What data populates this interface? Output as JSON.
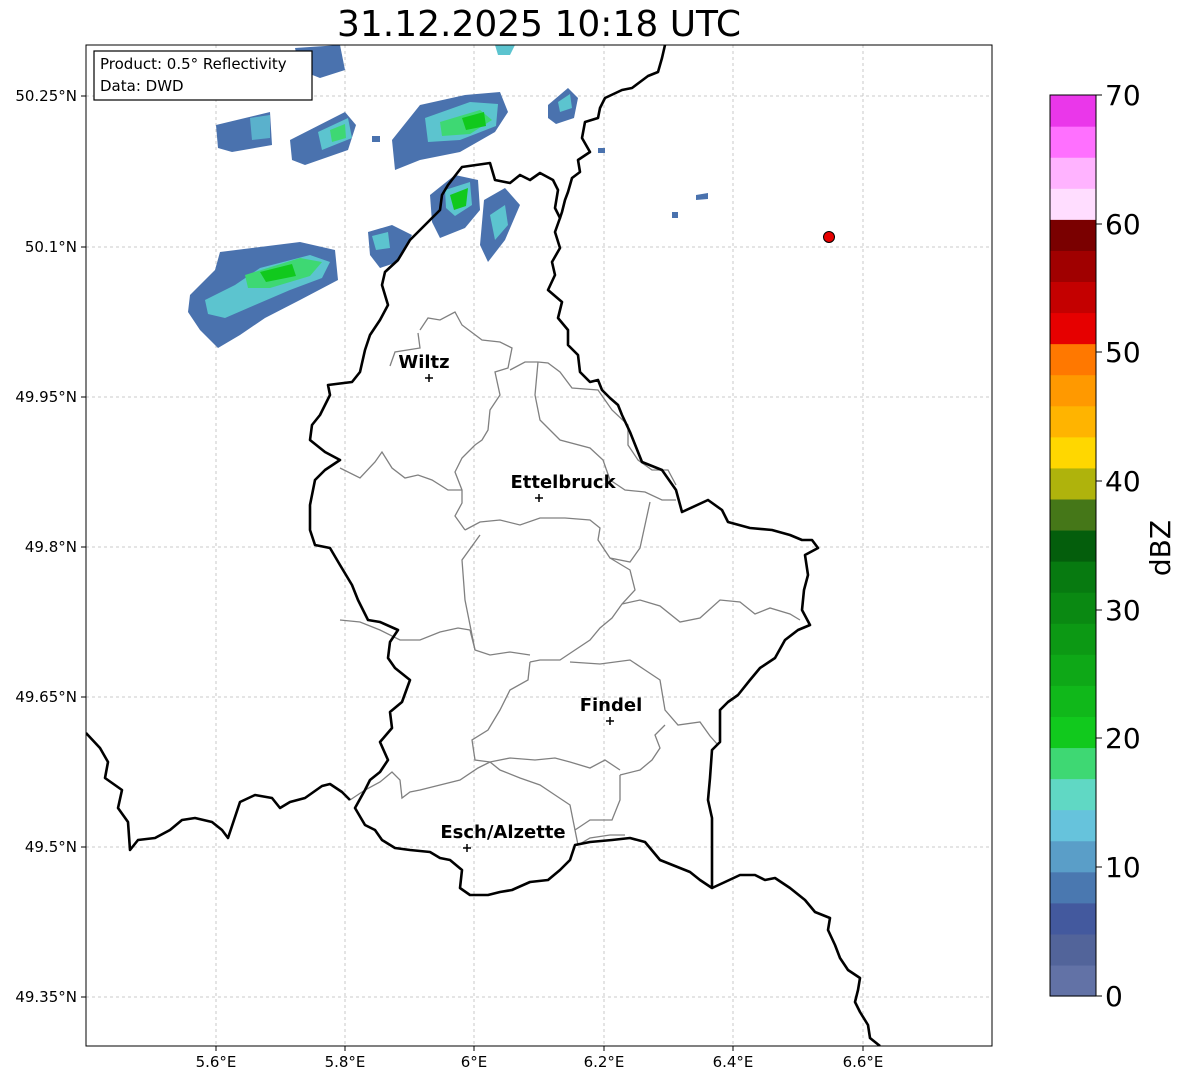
{
  "title": "31.12.2025 10:18 UTC",
  "info": {
    "product": "Product: 0.5° Reflectivity",
    "data": "Data: DWD"
  },
  "lat_ticks": [
    "50.25°N",
    "50.1°N",
    "49.95°N",
    "49.8°N",
    "49.65°N",
    "49.5°N",
    "49.35°N"
  ],
  "lon_ticks": [
    "5.6°E",
    "5.8°E",
    "6°E",
    "6.2°E",
    "6.4°E",
    "6.6°E"
  ],
  "cities": [
    {
      "name": "Wiltz"
    },
    {
      "name": "Ettelbruck"
    },
    {
      "name": "Findel"
    },
    {
      "name": "Esch/Alzette"
    }
  ],
  "colorbar": {
    "label": "dBZ",
    "ticks": [
      "0",
      "10",
      "20",
      "30",
      "40",
      "50",
      "60",
      "70"
    ],
    "colors": [
      "#6272a6",
      "#52649a",
      "#43599e",
      "#4a78b0",
      "#5a9ec8",
      "#66c3dc",
      "#60d8c4",
      "#3ed873",
      "#11c91d",
      "#10b81a",
      "#0ea817",
      "#0c9914",
      "#0a8912",
      "#077a10",
      "#045e0c",
      "#457718",
      "#afb30c",
      "#ffd700",
      "#ffb400",
      "#ff9900",
      "#ff7800",
      "#e60000",
      "#c40000",
      "#a00000",
      "#7a0000",
      "#ffddff",
      "#ffb3ff",
      "#ff70ff",
      "#ea37ea"
    ]
  },
  "marker_color": "#e60000"
}
